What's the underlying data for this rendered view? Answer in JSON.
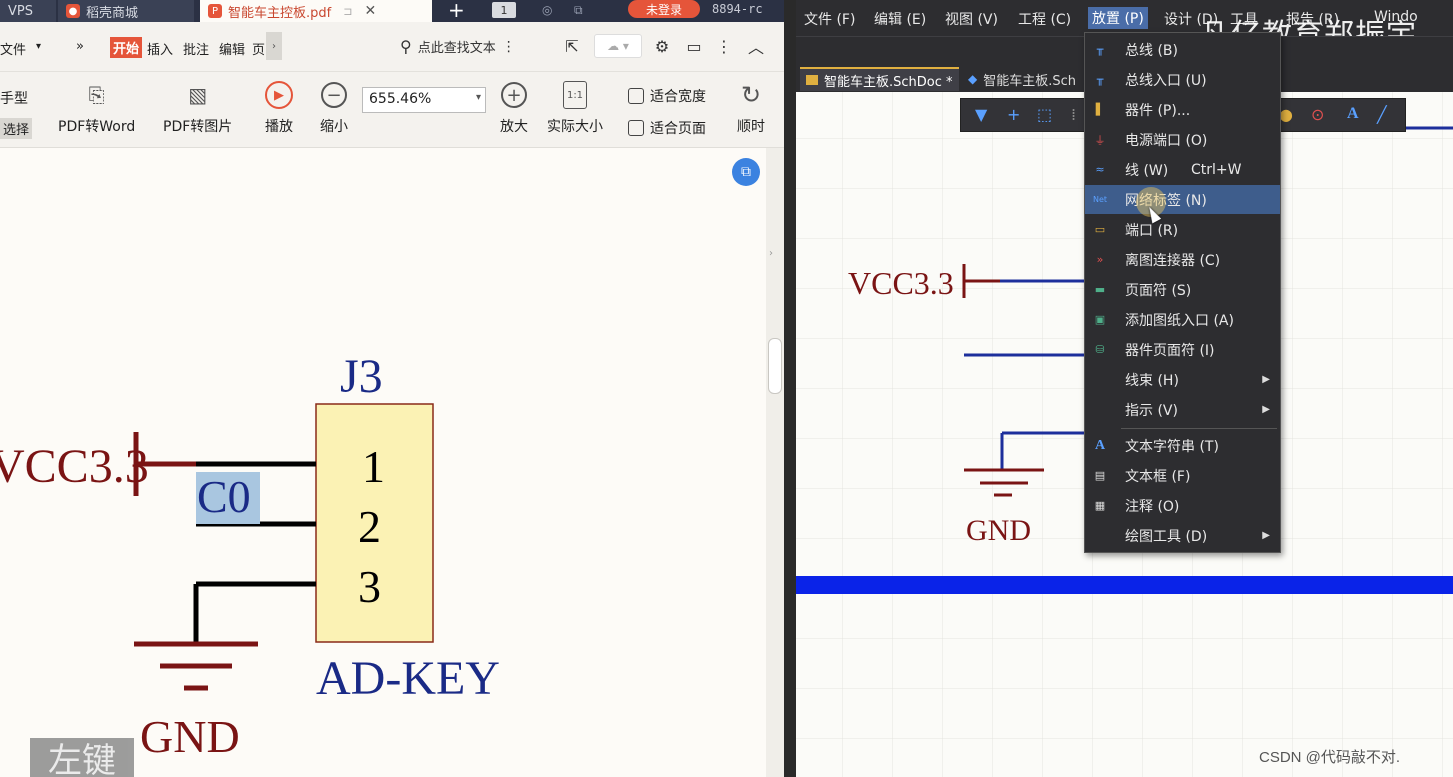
{
  "left_tabs": {
    "tab1": "VPS",
    "tab2": "稻壳商城",
    "tab3": "智能车主控板.pdf",
    "tab_count": "1",
    "login": "未登录",
    "code": "8894-rc"
  },
  "left_menu": {
    "file": "文件",
    "more": "»",
    "start": "开始",
    "insert": "插入",
    "annotate": "批注",
    "edit": "编辑",
    "page": "页",
    "search_text": "点此查找文本"
  },
  "left_toolbar": {
    "hand": "手型",
    "select": "选择",
    "pdf_word": "PDF转Word",
    "pdf_image": "PDF转图片",
    "play": "播放",
    "zoom_out": "缩小",
    "zoom_value": "655.46%",
    "zoom_in": "放大",
    "actual_size": "实际大小",
    "fit_width": "适合宽度",
    "fit_page": "适合页面",
    "rotate": "顺时",
    "one_to_one": "1:1"
  },
  "pdf_schematic": {
    "ref": "J3",
    "vcc": "VCC3.3",
    "net": "C0",
    "pins": [
      "1",
      "2",
      "3"
    ],
    "part": "AD-KEY",
    "gnd": "GND",
    "hint": "左键"
  },
  "right_menu": {
    "file": "文件 (F)",
    "edit": "编辑 (E)",
    "view": "视图 (V)",
    "project": "工程 (C)",
    "place": "放置 (P)",
    "design": "设计 (D)",
    "tools": "工具",
    "reports": "报告 (R)",
    "window": "Windo"
  },
  "watermark": "凡亿教育郑振宇",
  "right_tabs": {
    "tab1": "智能车主板.SchDoc *",
    "tab2": "智能车主板.Sch"
  },
  "right_schematic": {
    "vcc": "VCC3.3",
    "gnd": "GND"
  },
  "csdn": "CSDN @代码敲不对.",
  "place_menu": {
    "items": [
      {
        "label": "总线 (B)",
        "key": ""
      },
      {
        "label": "总线入口 (U)",
        "key": ""
      },
      {
        "label": "器件 (P)...",
        "key": ""
      },
      {
        "label": "电源端口 (O)",
        "key": ""
      },
      {
        "label": "线 (W)",
        "key": "Ctrl+W"
      },
      {
        "label": "网络标签 (N)",
        "key": ""
      },
      {
        "label": "端口 (R)",
        "key": ""
      },
      {
        "label": "离图连接器 (C)",
        "key": ""
      },
      {
        "label": "页面符 (S)",
        "key": ""
      },
      {
        "label": "添加图纸入口 (A)",
        "key": ""
      },
      {
        "label": "器件页面符 (I)",
        "key": ""
      },
      {
        "label": "线束 (H)",
        "key": ""
      },
      {
        "label": "指示 (V)",
        "key": ""
      },
      {
        "label": "文本字符串 (T)",
        "key": ""
      },
      {
        "label": "文本框 (F)",
        "key": ""
      },
      {
        "label": "注释 (O)",
        "key": ""
      },
      {
        "label": "绘图工具 (D)",
        "key": ""
      }
    ],
    "highlighted_index": 5
  },
  "colors": {
    "wps_accent": "#e5553a",
    "altium_menu_bg": "#2d2d30",
    "highlight": "#3e5d8c",
    "wire_blue": "#1d2f9c",
    "bus_blue": "#0a23e8",
    "power_red": "#7a1414",
    "comp_fill": "#fbf2b4",
    "comp_border": "#8a2b18",
    "netlabel_bg": "#a9c6e0"
  }
}
